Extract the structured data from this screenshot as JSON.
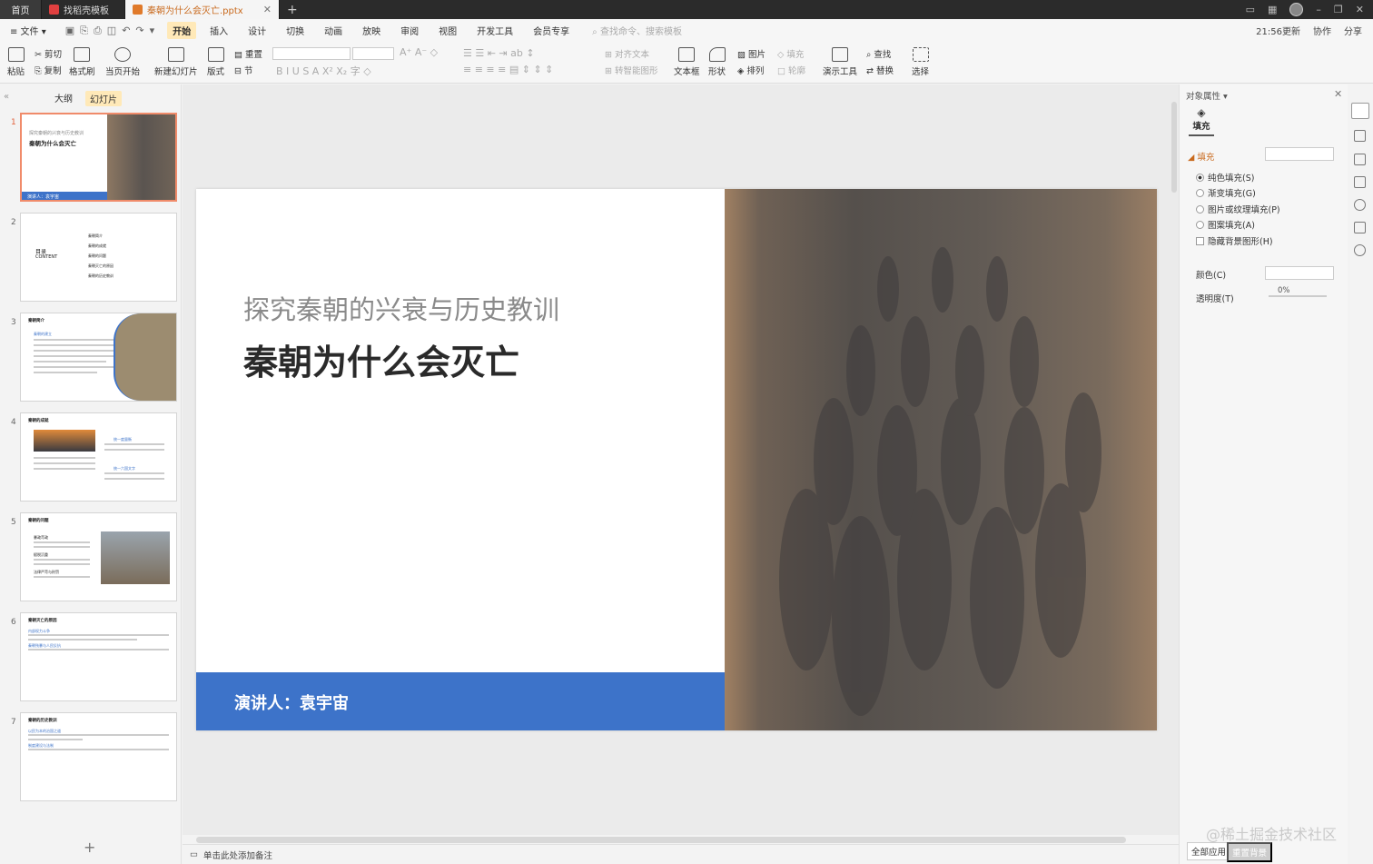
{
  "titlebar": {
    "tabs": [
      {
        "label": "首页"
      },
      {
        "label": "找稻壳模板"
      },
      {
        "label": "秦朝为什么会灭亡.pptx"
      }
    ]
  },
  "menu": {
    "file": "≡ 文件 ▾",
    "items": [
      "开始",
      "插入",
      "设计",
      "切换",
      "动画",
      "放映",
      "审阅",
      "视图",
      "开发工具",
      "会员专享"
    ],
    "search_placeholder": "查找命令、搜索模板",
    "right": [
      "21:56更新",
      "协作",
      "分享"
    ]
  },
  "ribbon": {
    "paste": "粘贴",
    "cut": "剪切",
    "copy": "复制",
    "format_painter": "格式刷",
    "play": "当页开始",
    "new_slide": "新建幻灯片",
    "layout": "版式",
    "reset": "重置",
    "section": "节",
    "align_text": "对齐文本",
    "smart_art": "转智能图形",
    "textbox": "文本框",
    "shape": "形状",
    "picture": "图片",
    "arrange": "排列",
    "fill": "填充",
    "outline": "轮廓",
    "present_tools": "演示工具",
    "find": "查找",
    "replace": "替换",
    "select": "选择"
  },
  "leftpanel": {
    "tabs": [
      "大纲",
      "幻灯片"
    ],
    "thumbs": [
      {
        "num": "1",
        "title": "秦朝为什么会灭亡",
        "subtitle": "探究秦朝的兴衰与历史教训",
        "footer": "演讲人：袁宇宙"
      },
      {
        "num": "2",
        "title": "目录",
        "subtitle": "CONTENT",
        "items": [
          "秦朝简介",
          "秦朝的成就",
          "秦朝的问题",
          "秦朝灭亡的原因",
          "秦朝的历史教训"
        ]
      },
      {
        "num": "3",
        "title": "秦朝简介",
        "heading": "秦朝的建立"
      },
      {
        "num": "4",
        "title": "秦朝的成就",
        "heading": "统一度量衡",
        "heading2": "统一六国文字"
      },
      {
        "num": "5",
        "title": "秦朝的问题",
        "items": [
          "暴政苛政",
          "赋税沉重",
          "法律严苛与刑罚"
        ]
      },
      {
        "num": "6",
        "title": "秦朝灭亡的原因",
        "items": [
          "内部权力斗争",
          "秦朝残暴与人民反抗"
        ]
      },
      {
        "num": "7",
        "title": "秦朝的历史教训",
        "items": [
          "以民为本的治国之道",
          "制度建设与法制"
        ]
      }
    ]
  },
  "slide": {
    "subtitle": "探究秦朝的兴衰与历史教训",
    "title": "秦朝为什么会灭亡",
    "presenter": "演讲人：袁宇宙",
    "accent": "#3d73c9"
  },
  "notes": {
    "placeholder": "单击此处添加备注"
  },
  "properties": {
    "header": "对象属性 ▾",
    "tab": "填充",
    "section": "填充",
    "options": [
      "纯色填充(S)",
      "渐变填充(G)",
      "图片或纹理填充(P)",
      "图案填充(A)"
    ],
    "selected_option": "纯色填充(S)",
    "hide_bg": "隐藏背景图形(H)",
    "color_label": "颜色(C)",
    "transparency_label": "透明度(T)",
    "transparency_value": "0%",
    "apply_all": "全部应用",
    "reset_bg": "重置背景"
  },
  "watermark": "@稀土掘金技术社区"
}
